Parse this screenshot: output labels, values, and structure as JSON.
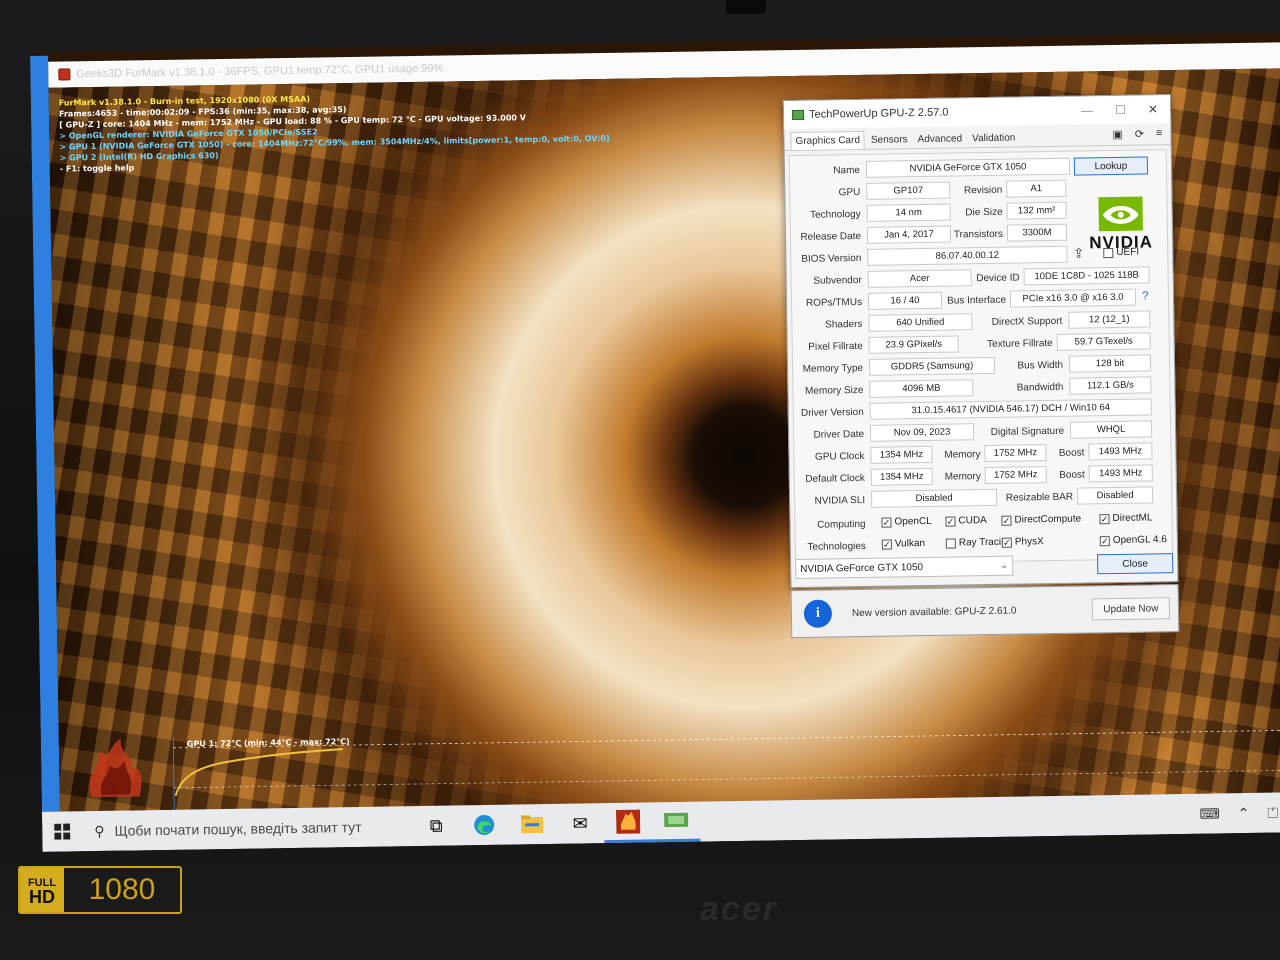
{
  "furmark": {
    "title": "Geeks3D FurMark v1.38.1.0 - 36FPS, GPU1 temp:72°C, GPU1 usage:99%",
    "overlay": [
      {
        "text": "FurMark v1.38.1.0 - Burn-in test, 1920x1080 (0X MSAA)",
        "color": "yellow"
      },
      {
        "text": "Frames:4653 - time:00:02:09 - FPS:36 (min:35, max:38, avg:35)",
        "color": "white"
      },
      {
        "text": "[ GPU-Z ] core: 1404 MHz - mem: 1752 MHz - GPU load: 88 % - GPU temp: 72 °C - GPU voltage: 93.000 V",
        "color": "white"
      },
      {
        "text": "> OpenGL renderer: NVIDIA GeForce GTX 1050/PCIe/SSE2",
        "color": "cyan"
      },
      {
        "text": "> GPU 1 (NVIDIA GeForce GTX 1050) - core: 1404MHz:72°C/99%, mem: 3504MHz/4%, limits[power:1, temp:0, volt:0, OV:0]",
        "color": "cyan"
      },
      {
        "text": "> GPU 2 (Intel(R) HD Graphics 630)",
        "color": "cyan"
      },
      {
        "text": "- F1: toggle help",
        "color": "white"
      }
    ],
    "graph_label": "GPU 1: 72°C (min: 44°C - max: 72°C)"
  },
  "gpuz": {
    "title": "TechPowerUp GPU-Z 2.57.0",
    "tabs": [
      "Graphics Card",
      "Sensors",
      "Advanced",
      "Validation"
    ],
    "labels": {
      "name": "Name",
      "gpu": "GPU",
      "revision": "Revision",
      "technology": "Technology",
      "die_size": "Die Size",
      "release_date": "Release Date",
      "transistors": "Transistors",
      "bios_version": "BIOS Version",
      "subvendor": "Subvendor",
      "device_id": "Device ID",
      "rops_tmus": "ROPs/TMUs",
      "bus_interface": "Bus Interface",
      "shaders": "Shaders",
      "directx_support": "DirectX Support",
      "pixel_fillrate": "Pixel Fillrate",
      "texture_fillrate": "Texture Fillrate",
      "memory_type": "Memory Type",
      "bus_width": "Bus Width",
      "memory_size": "Memory Size",
      "bandwidth": "Bandwidth",
      "driver_version": "Driver Version",
      "driver_date": "Driver Date",
      "digital_signature": "Digital Signature",
      "gpu_clock": "GPU Clock",
      "memory": "Memory",
      "boost": "Boost",
      "default_clock": "Default Clock",
      "nvidia_sli": "NVIDIA SLI",
      "resizable_bar": "Resizable BAR",
      "computing": "Computing",
      "technologies": "Technologies"
    },
    "values": {
      "name": "NVIDIA GeForce GTX 1050",
      "gpu": "GP107",
      "revision": "A1",
      "technology": "14 nm",
      "die_size": "132 mm²",
      "release_date": "Jan 4, 2017",
      "transistors": "3300M",
      "bios_version": "86.07.40.00.12",
      "subvendor": "Acer",
      "device_id": "10DE 1C8D - 1025 118B",
      "rops_tmus": "16 / 40",
      "bus_interface": "PCIe x16 3.0 @ x16 3.0",
      "shaders": "640 Unified",
      "directx_support": "12 (12_1)",
      "pixel_fillrate": "23.9 GPixel/s",
      "texture_fillrate": "59.7 GTexel/s",
      "memory_type": "GDDR5 (Samsung)",
      "bus_width": "128 bit",
      "memory_size": "4096 MB",
      "bandwidth": "112.1 GB/s",
      "driver_version": "31.0.15.4617 (NVIDIA 546.17) DCH / Win10 64",
      "driver_date": "Nov 09, 2023",
      "digital_signature": "WHQL",
      "gpu_clock": "1354 MHz",
      "memory_clock": "1752 MHz",
      "boost_clock": "1493 MHz",
      "default_clock": "1354 MHz",
      "default_memory": "1752 MHz",
      "default_boost": "1493 MHz",
      "nvidia_sli": "Disabled",
      "resizable_bar": "Disabled"
    },
    "lookup_label": "Lookup",
    "uefi_label": "UEFI",
    "help_glyph": "?",
    "vendor_logo": "NVIDIA",
    "computing": [
      {
        "label": "OpenCL",
        "checked": true
      },
      {
        "label": "CUDA",
        "checked": true
      },
      {
        "label": "DirectCompute",
        "checked": true
      },
      {
        "label": "DirectML",
        "checked": true
      }
    ],
    "technologies": [
      {
        "label": "Vulkan",
        "checked": true
      },
      {
        "label": "Ray Tracing",
        "checked": false
      },
      {
        "label": "PhysX",
        "checked": true
      },
      {
        "label": "OpenGL 4.6",
        "checked": true
      }
    ],
    "selected_gpu": "NVIDIA GeForce GTX 1050",
    "close_label": "Close"
  },
  "update": {
    "message": "New version available: GPU-Z 2.61.0",
    "button": "Update Now"
  },
  "taskbar": {
    "search_placeholder": "Щоби почати пошук, введіть запит тут"
  },
  "sticker": {
    "full": "FULL",
    "hd": "HD",
    "resolution": "1080"
  },
  "brand": "acer",
  "colors": {
    "furmark_sidebar": "#2f7fe0",
    "accent_blue": "#2b6fd0",
    "overlay_yellow": "#ffe94a",
    "overlay_cyan": "#6fd6ff"
  }
}
